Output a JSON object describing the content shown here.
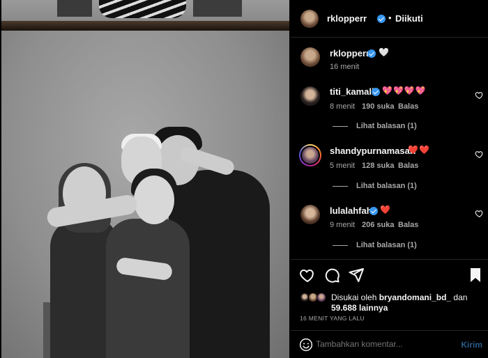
{
  "post": {
    "author": "rklopperr",
    "follow_status": "Diikuti",
    "separator": "•",
    "caption_emoji": "🤍",
    "caption_time": "16 menit"
  },
  "comments": [
    {
      "username": "titi_kamall",
      "emoji": "💖💖💖💖",
      "time": "8 menit",
      "likes_count": "190",
      "likes_word": "suka",
      "reply_label": "Balas",
      "view_replies": "Lihat balasan (1)"
    },
    {
      "username": "shandypurnamasari",
      "emoji": "❤️❤️",
      "time": "5 menit",
      "likes_count": "128",
      "likes_word": "suka",
      "reply_label": "Balas",
      "view_replies": "Lihat balasan (1)"
    },
    {
      "username": "lulalahfah",
      "emoji": "❤️",
      "time": "9 menit",
      "likes_count": "206",
      "likes_word": "suka",
      "reply_label": "Balas",
      "view_replies": "Lihat balasan (1)"
    }
  ],
  "likes": {
    "prefix": "Disukai oleh",
    "liker": "bryandomani_bd_",
    "joiner": "dan",
    "count": "59.688 lainnya"
  },
  "posted_ago": "16 MENIT YANG LALU",
  "comment_input": {
    "placeholder": "Tambahkan komentar...",
    "post_label": "Kirim"
  },
  "icons": {
    "like": "heart-icon",
    "comment": "comment-icon",
    "share": "paper-plane-icon",
    "save": "bookmark-icon",
    "emoji": "smiley-icon",
    "verified": "verified-badge-icon"
  },
  "colors": {
    "background": "#000000",
    "text_primary": "#f5f5f5",
    "text_secondary": "#a8a8a8",
    "verified": "#3897f0",
    "divider": "#262626",
    "post_disabled": "#2a5a8a"
  }
}
